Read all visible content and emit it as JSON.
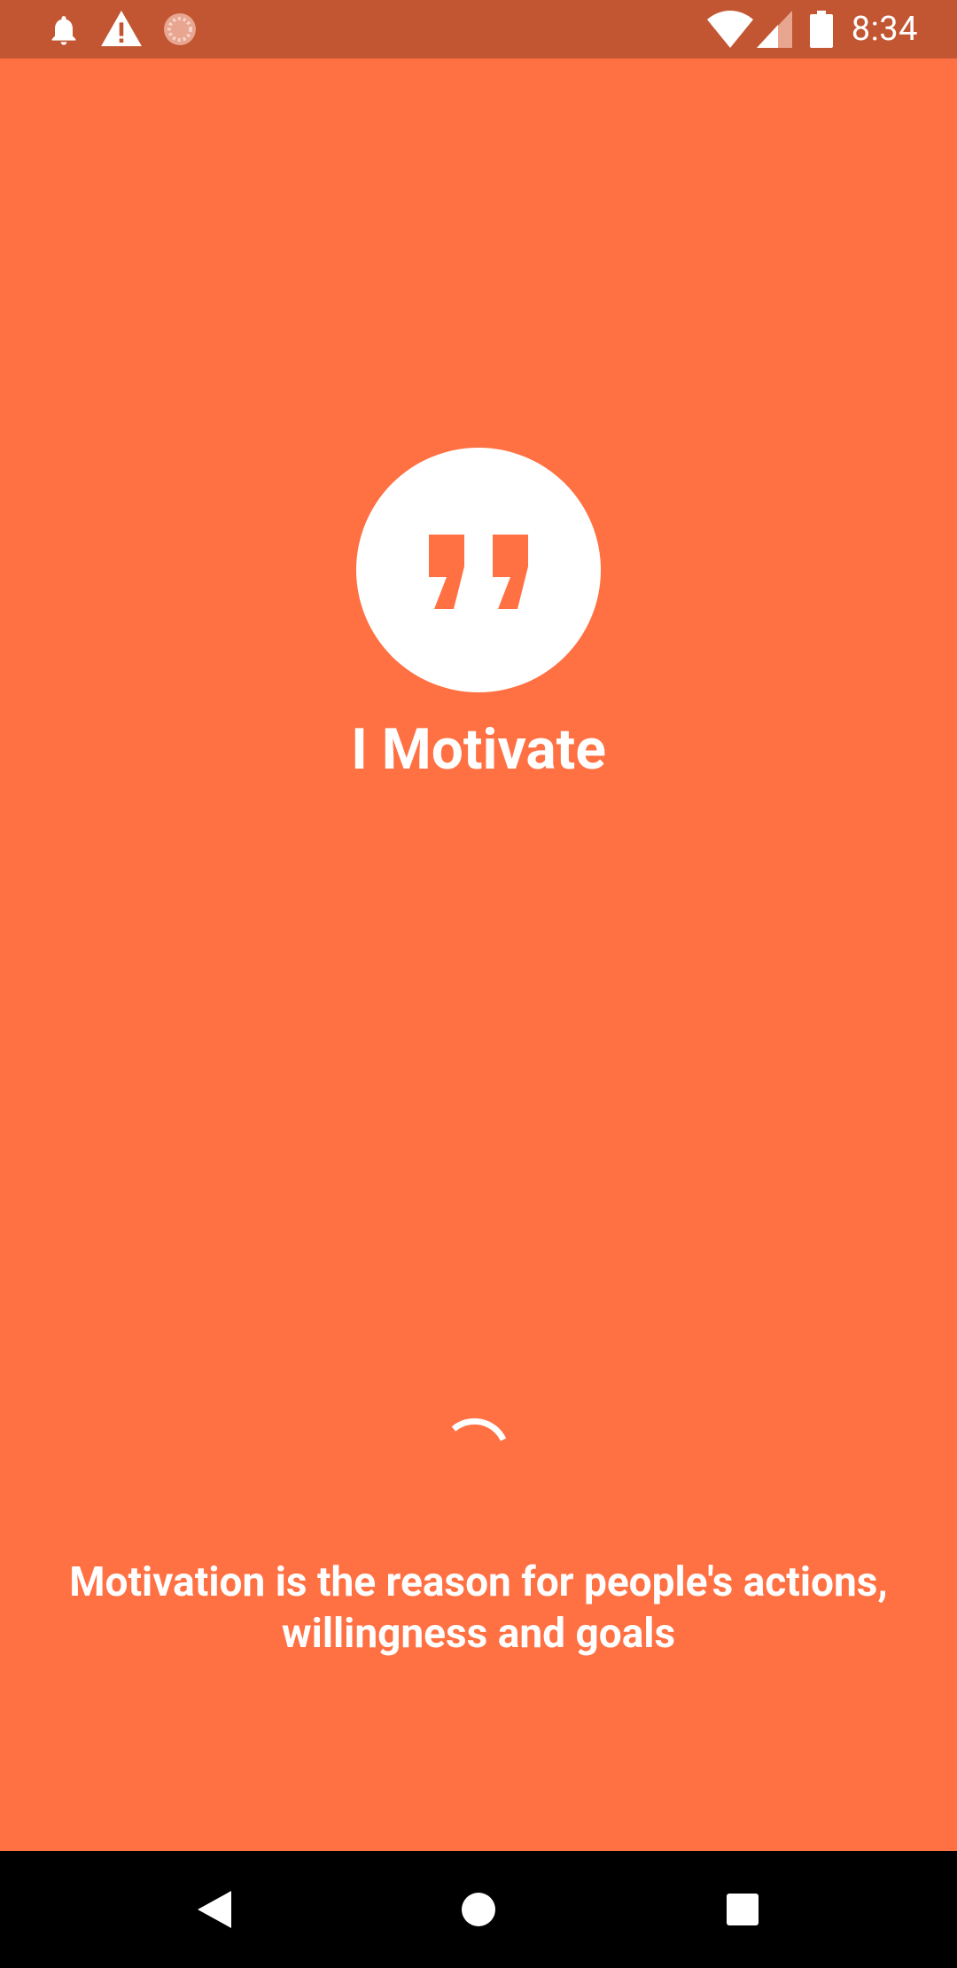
{
  "status_bar": {
    "time": "8:34",
    "left_icons": [
      "bell-icon",
      "warning-icon",
      "sync-icon"
    ],
    "right_icons": [
      "wifi-icon",
      "cell-signal-icon",
      "battery-icon"
    ]
  },
  "app": {
    "title": "I Motivate",
    "logo_icon": "quote-icon",
    "tagline": "Motivation is the reason for people's actions, willingness and goals"
  },
  "loading": {
    "indicator": "loading-spinner-icon"
  },
  "nav_bar": {
    "buttons": [
      "back-icon",
      "home-icon",
      "recents-icon"
    ]
  },
  "colors": {
    "background": "#FF7043",
    "status_bar": "#C25633",
    "foreground": "#FFFFFF",
    "nav_bar": "#000000"
  }
}
